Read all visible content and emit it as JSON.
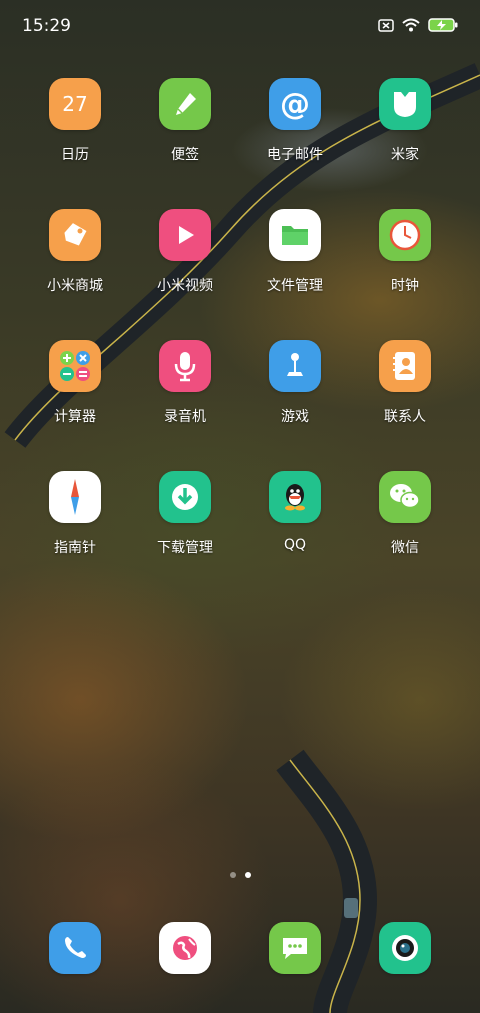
{
  "status": {
    "time": "15:29"
  },
  "calendar_day": "27",
  "apps": [
    {
      "label": "日历",
      "icon": "calendar-icon",
      "bg": "#f6a04b"
    },
    {
      "label": "便签",
      "icon": "notes-icon",
      "bg": "#75c84a"
    },
    {
      "label": "电子邮件",
      "icon": "email-icon",
      "bg": "#3f9ee8"
    },
    {
      "label": "米家",
      "icon": "mijia-icon",
      "bg": "#22c28d"
    },
    {
      "label": "小米商城",
      "icon": "mi-store-icon",
      "bg": "#f6a04b"
    },
    {
      "label": "小米视频",
      "icon": "video-icon",
      "bg": "#ef4f7f"
    },
    {
      "label": "文件管理",
      "icon": "file-manager-icon",
      "bg": "#ffffff"
    },
    {
      "label": "时钟",
      "icon": "clock-icon",
      "bg": "#75c84a"
    },
    {
      "label": "计算器",
      "icon": "calculator-icon",
      "bg": "#f6a04b"
    },
    {
      "label": "录音机",
      "icon": "recorder-icon",
      "bg": "#ef4f7f"
    },
    {
      "label": "游戏",
      "icon": "game-icon",
      "bg": "#3f9ee8"
    },
    {
      "label": "联系人",
      "icon": "contacts-icon",
      "bg": "#f6a04b"
    },
    {
      "label": "指南针",
      "icon": "compass-icon",
      "bg": "#ffffff"
    },
    {
      "label": "下载管理",
      "icon": "download-icon",
      "bg": "#22c28d"
    },
    {
      "label": "QQ",
      "icon": "qq-icon",
      "bg": "#22c28d"
    },
    {
      "label": "微信",
      "icon": "wechat-icon",
      "bg": "#75c84a"
    }
  ],
  "page_indicator": {
    "pages": 2,
    "current": 2
  },
  "dock": [
    {
      "icon": "phone-icon",
      "bg": "#3f9ee8"
    },
    {
      "icon": "browser-icon",
      "bg": "#ffffff"
    },
    {
      "icon": "messages-icon",
      "bg": "#75c84a"
    },
    {
      "icon": "camera-icon",
      "bg": "#22c28d"
    }
  ]
}
